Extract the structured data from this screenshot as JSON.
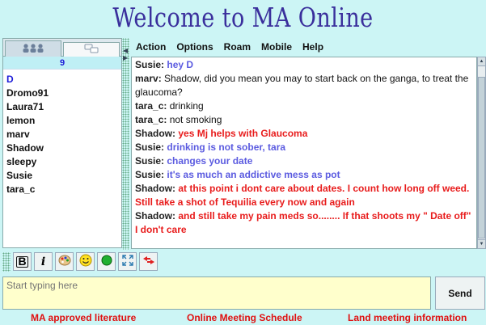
{
  "app": {
    "title": "Welcome to MA Online"
  },
  "tabs": [
    {
      "label": "",
      "icon": "users-icon"
    },
    {
      "label": "",
      "icon": "chat-bubbles-icon"
    }
  ],
  "users": {
    "count": "9",
    "items": [
      "D",
      "Dromo91",
      "Laura71",
      "lemon",
      "marv",
      "Shadow",
      "sleepy",
      "Susie",
      "tara_c"
    ]
  },
  "menu": [
    "Action",
    "Options",
    "Roam",
    "Mobile",
    "Help"
  ],
  "messages": [
    {
      "user": "Susie:",
      "text": "hey D",
      "color": "#5b5be0",
      "bold": true
    },
    {
      "user": "marv:",
      "text": "Shadow, did you mean you may to start back on the ganga, to treat the glaucoma?",
      "color": "#111111",
      "bold": false
    },
    {
      "user": "tara_c:",
      "text": "drinking",
      "color": "#111111",
      "bold": false
    },
    {
      "user": "tara_c:",
      "text": "not smoking",
      "color": "#111111",
      "bold": false
    },
    {
      "user": "Shadow:",
      "text": "yes Mj helps with Glaucoma",
      "color": "#e81c1c",
      "bold": true
    },
    {
      "user": "Susie:",
      "text": "drinking is not sober, tara",
      "color": "#5b5be0",
      "bold": true
    },
    {
      "user": "Susie:",
      "text": "changes your date",
      "color": "#5b5be0",
      "bold": true
    },
    {
      "user": "Susie:",
      "text": "it's as much an addictive mess as pot",
      "color": "#5b5be0",
      "bold": true
    },
    {
      "user": "Shadow:",
      "text": "at this point i dont care about dates. I count how long off weed. Still take a shot of Tequilia every now and again",
      "color": "#e81c1c",
      "bold": true
    },
    {
      "user": "Shadow:",
      "text": "and still take my pain meds so........  If that shoots my \" Date off\" I don't care",
      "color": "#e81c1c",
      "bold": true
    }
  ],
  "toolbar": {
    "bold_label": "B",
    "italic_label": "i",
    "icons": [
      "palette-icon",
      "smiley-icon",
      "green-circle-icon",
      "expand-icon",
      "arrows-icon"
    ]
  },
  "input": {
    "placeholder": "Start typing here"
  },
  "send": {
    "label": "Send"
  },
  "footer": {
    "links": [
      {
        "label": "MA approved literature",
        "color": "#e01010"
      },
      {
        "label": "Online Meeting Schedule",
        "color": "#e01010"
      },
      {
        "label": "Land meeting information",
        "color": "#e01010"
      }
    ]
  },
  "colors": {
    "background": "#ccf5f5",
    "title": "#3a2f9c",
    "input_bg": "#ffffcc"
  }
}
